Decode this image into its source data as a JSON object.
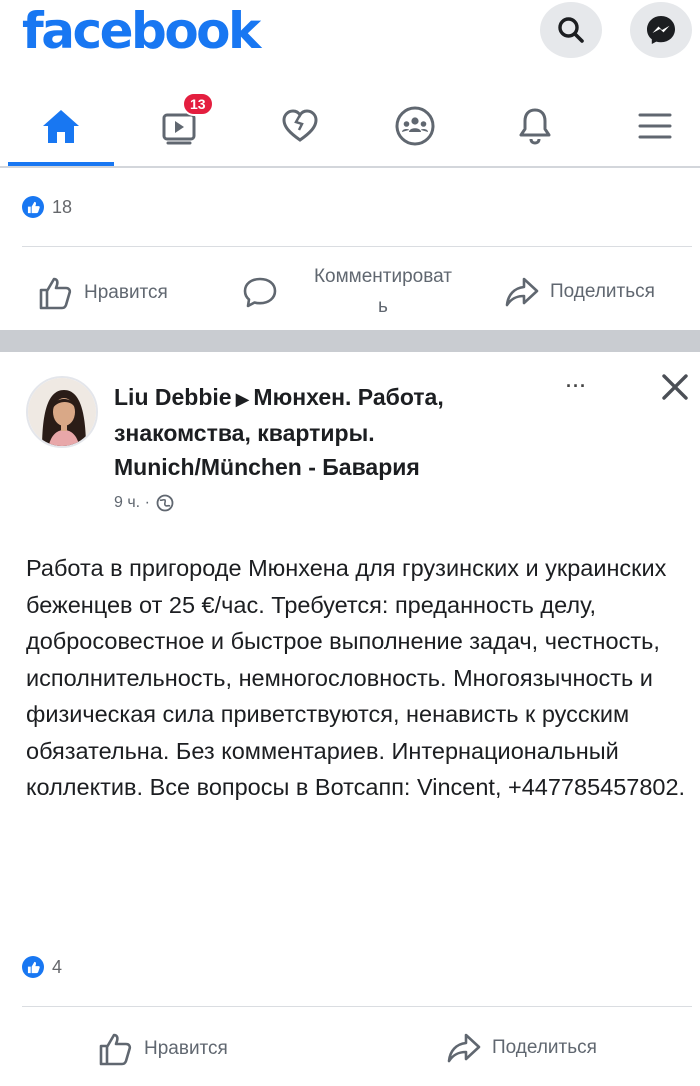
{
  "app": {
    "logo_text": "facebook",
    "brand_color": "#1877f2"
  },
  "top_actions": [
    "search-icon",
    "messenger-icon"
  ],
  "nav": {
    "items": [
      {
        "icon": "home-icon",
        "active": true
      },
      {
        "icon": "watch-icon",
        "badge": "13"
      },
      {
        "icon": "dating-heart-icon"
      },
      {
        "icon": "groups-icon"
      },
      {
        "icon": "bell-icon"
      },
      {
        "icon": "menu-icon"
      }
    ]
  },
  "prev_post": {
    "reactions_count": "18",
    "like_label": "Нравится",
    "comment_label_line1": "Комментироват",
    "comment_label_line2": "ь",
    "share_label": "Поделиться"
  },
  "post": {
    "author": "Liu Debbie",
    "group": "Мюнхен. Работа, знакомства, квартиры. Munich/München - Бавария",
    "time": "9 ч. ·",
    "more": "···",
    "body": "Работа в пригороде Мюнхена для грузинских и украинских беженцев от 25 €/час.  Требуется: преданность делу, добросовестное и быстрое выполнение задач, честность, исполнительность, немногословность. Многоязычность и физическая сила приветствуются, ненависть к русским обязательна.  Без комментариев. Интернациональный коллектив.  Все вопросы в Вотсапп: Vincent, +447785457802.",
    "reactions_count": "4",
    "like_label": "Нравится",
    "share_label": "Поделиться"
  }
}
